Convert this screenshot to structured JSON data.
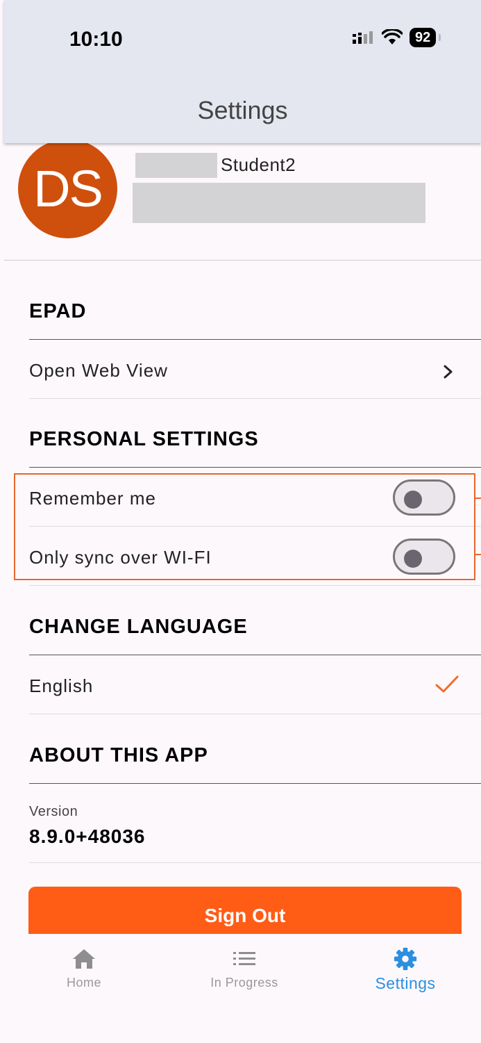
{
  "status_bar": {
    "time": "10:10",
    "battery": "92"
  },
  "header": {
    "title": "Settings"
  },
  "profile": {
    "initials": "DS",
    "name": "Student2"
  },
  "sections": {
    "epad": {
      "title": "EPAD",
      "open_web_view": "Open Web View"
    },
    "personal": {
      "title": "PERSONAL SETTINGS",
      "remember_me": {
        "label": "Remember me",
        "enabled": false
      },
      "wifi_sync": {
        "label": "Only sync over WI-FI",
        "enabled": false
      }
    },
    "language": {
      "title": "CHANGE LANGUAGE",
      "selected": "English"
    },
    "about": {
      "title": "ABOUT THIS APP",
      "version_label": "Version",
      "version_value": "8.9.0+48036"
    }
  },
  "sign_out": {
    "label": "Sign Out"
  },
  "bottom_nav": {
    "items": [
      {
        "label": "Home",
        "icon": "home-icon"
      },
      {
        "label": "In Progress",
        "icon": "list-icon"
      },
      {
        "label": "Settings",
        "icon": "gear-icon",
        "active": true
      }
    ]
  },
  "colors": {
    "accent": "#ff5c16",
    "avatar": "#cf4f0d",
    "active_nav": "#2a8fe0",
    "highlight": "#e8662a"
  }
}
